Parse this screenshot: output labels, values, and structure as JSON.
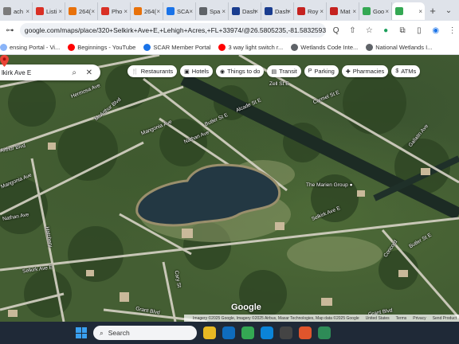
{
  "tabs": [
    {
      "label": "ach",
      "color": "#7b7b7b"
    },
    {
      "label": "Listi",
      "color": "#d93025"
    },
    {
      "label": "264(",
      "color": "#e8710a"
    },
    {
      "label": "Pho",
      "color": "#d93025"
    },
    {
      "label": "264(",
      "color": "#e8710a"
    },
    {
      "label": "SCA",
      "color": "#1a73e8"
    },
    {
      "label": "Spa",
      "color": "#5f6368"
    },
    {
      "label": "Dash",
      "color": "#1a3d8f"
    },
    {
      "label": "Dash",
      "color": "#1a3d8f"
    },
    {
      "label": "Roy",
      "color": "#c5221f"
    },
    {
      "label": "Mat",
      "color": "#c5221f"
    },
    {
      "label": "Goo",
      "color": "#34a853"
    },
    {
      "label": "",
      "color": "#34a853"
    }
  ],
  "newtab_label": "+",
  "window": {
    "chevron": "⌄"
  },
  "address": {
    "url": "google.com/maps/place/320+Selkirk+Ave+E,+Lehigh+Acres,+FL+33974/@26.5805235,-81.5832593,5..."
  },
  "toolbar_icons": [
    "Q",
    "⇧",
    "☆"
  ],
  "bookmarks": [
    {
      "label": "ensing Portal - Vi...",
      "color": "#8ab4f8"
    },
    {
      "label": "Beginnings - YouTube",
      "color": "#ff0000"
    },
    {
      "label": "SCAR Member Portal",
      "color": "#1a73e8"
    },
    {
      "label": "3 way light switch r...",
      "color": "#ff0000"
    },
    {
      "label": "Wetlands Code Inte...",
      "color": "#5f6368"
    },
    {
      "label": "National Wetlands I...",
      "color": "#5f6368"
    }
  ],
  "map": {
    "search_value": "lkirk Ave E",
    "chips": [
      {
        "icon": "🍴",
        "label": "Restaurants"
      },
      {
        "icon": "▣",
        "label": "Hotels"
      },
      {
        "icon": "◉",
        "label": "Things to do"
      },
      {
        "icon": "▤",
        "label": "Transit"
      },
      {
        "icon": "P",
        "label": "Parking"
      },
      {
        "icon": "✚",
        "label": "Pharmacies"
      },
      {
        "icon": "$",
        "label": "ATMs"
      }
    ],
    "road_labels": [
      "Hermosa Ave",
      "McArthur Blvd",
      "Mangonia Ave",
      "Nathan Ave",
      "Butler St E",
      "Alcade St E",
      "Zell St E",
      "Carmel St E",
      "Gallatin Ave",
      "Arthur Blvd",
      "Mangonia Ave",
      "Nathan Ave",
      "Hatchery",
      "Selkirk Ave E",
      "Selkirk Ave E",
      "Cary St",
      "Grant Blvd",
      "Grant Blvd",
      "Butler St E",
      "Concord"
    ],
    "poi": {
      "name": "The Marien Group"
    },
    "google_logo": "Google",
    "attribution": [
      "Imagery ©2025 Google, Imagery ©2025 Airbus, Maxar Technologies, Map data ©2025 Google",
      "United States",
      "Terms",
      "Privacy",
      "Send Product"
    ]
  },
  "taskbar": {
    "search_label": "Search",
    "apps": [
      {
        "name": "file-explorer",
        "color": "#e8b923"
      },
      {
        "name": "mail",
        "color": "#0f6cbd"
      },
      {
        "name": "chrome",
        "color": "#34a853"
      },
      {
        "name": "edge",
        "color": "#0b84d8"
      },
      {
        "name": "store",
        "color": "#444444"
      },
      {
        "name": "media",
        "color": "#e0552c"
      },
      {
        "name": "browser",
        "color": "#2e8b57"
      }
    ]
  }
}
